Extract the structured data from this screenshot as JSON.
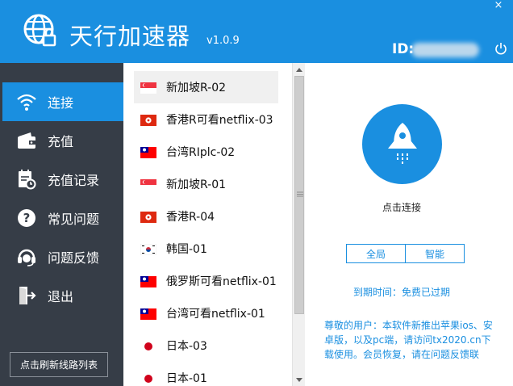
{
  "header": {
    "title": "天行加速器",
    "version": "v1.0.9",
    "id_label": "ID:",
    "close_symbol": "×"
  },
  "sidebar": {
    "items": [
      {
        "label": "连接",
        "icon": "wifi-icon",
        "active": true
      },
      {
        "label": "充值",
        "icon": "wallet-icon",
        "active": false
      },
      {
        "label": "充值记录",
        "icon": "record-icon",
        "active": false
      },
      {
        "label": "常见问题",
        "icon": "question-icon",
        "active": false
      },
      {
        "label": "问题反馈",
        "icon": "headset-icon",
        "active": false
      },
      {
        "label": "退出",
        "icon": "exit-icon",
        "active": false
      }
    ],
    "refresh_label": "点击刷新线路列表"
  },
  "servers": [
    {
      "label": "新加坡R-02",
      "flag": "singapore-flag",
      "selected": true
    },
    {
      "label": "香港R可看netflix-03",
      "flag": "hongkong-flag",
      "selected": false
    },
    {
      "label": "台湾RIplc-02",
      "flag": "taiwan-flag",
      "selected": false
    },
    {
      "label": "新加坡R-01",
      "flag": "singapore-flag",
      "selected": false
    },
    {
      "label": "香港R-04",
      "flag": "hongkong-flag",
      "selected": false
    },
    {
      "label": "韩国-01",
      "flag": "korea-flag",
      "selected": false
    },
    {
      "label": "俄罗斯可看netflix-01",
      "flag": "taiwan-flag",
      "selected": false
    },
    {
      "label": "台湾可看netflix-01",
      "flag": "taiwan-flag",
      "selected": false
    },
    {
      "label": "日本-03",
      "flag": "japan-flag",
      "selected": false
    },
    {
      "label": "日本-01",
      "flag": "japan-flag",
      "selected": false
    }
  ],
  "panel": {
    "connect_label": "点击连接",
    "mode_global": "全局",
    "mode_smart": "智能",
    "expiry": "到期时间：免费已过期",
    "notice": "尊敬的用户：本软件新推出苹果ios、安卓版，以及pc端，请访问tx2020.cn下载使用。会员恢复，请在问题反馈联"
  },
  "colors": {
    "accent": "#1a8fe0",
    "sidebar_bg": "#363d47"
  }
}
